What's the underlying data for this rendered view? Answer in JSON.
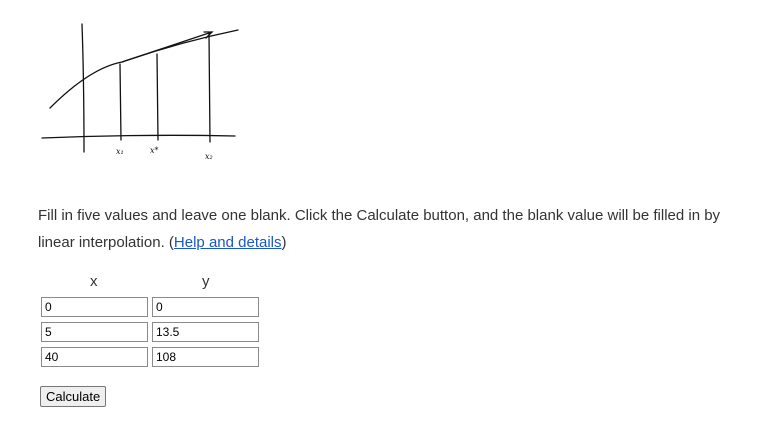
{
  "diagram": {
    "labels": [
      "x₁",
      "x*",
      "x₂"
    ]
  },
  "instructions": {
    "text": "Fill in five values and leave one blank. Click the Calculate button, and the blank value will be filled in by linear interpolation. (",
    "link": "Help and details",
    "suffix": ")"
  },
  "table": {
    "headers": {
      "x": "x",
      "y": "y"
    },
    "rows": [
      {
        "x": "0",
        "y": "0"
      },
      {
        "x": "5",
        "y": "13.5"
      },
      {
        "x": "40",
        "y": "108"
      }
    ]
  },
  "calculate_button": "Calculate"
}
